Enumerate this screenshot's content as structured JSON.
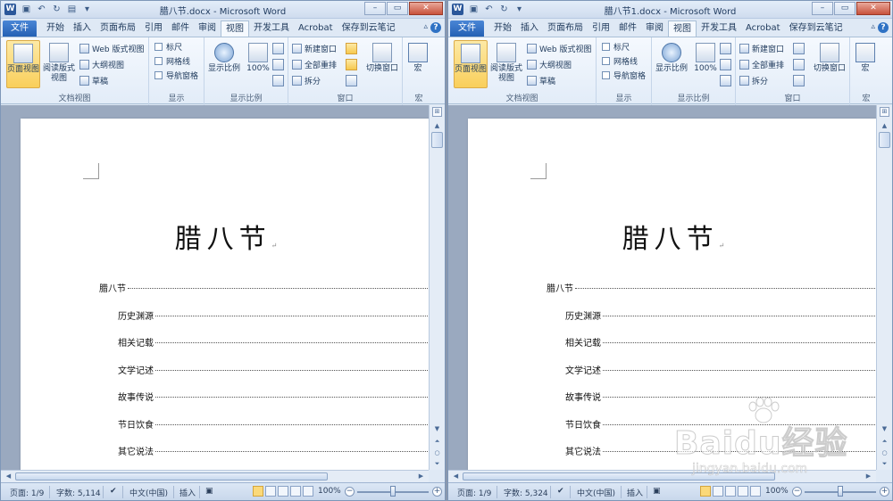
{
  "windows": [
    {
      "title": "腊八节.docx - Microsoft Word",
      "word_count": "字数: 5,114"
    },
    {
      "title": "腊八节1.docx - Microsoft Word",
      "word_count": "字数: 5,324"
    }
  ],
  "common": {
    "app_icon": "W",
    "file_tab": "文件",
    "tabs": [
      "开始",
      "插入",
      "页面布局",
      "引用",
      "邮件",
      "审阅",
      "视图",
      "开发工具",
      "Acrobat",
      "保存到云笔记"
    ],
    "active_tab": "视图",
    "ribbon": {
      "doc_views": {
        "label": "文档视图",
        "page_view": "页面视图",
        "reading_view": "阅读版式视图",
        "web_view": "Web 版式视图",
        "outline": "大纲视图",
        "draft": "草稿"
      },
      "show": {
        "label": "显示",
        "ruler": "标尺",
        "gridlines": "网格线",
        "nav_pane": "导航窗格"
      },
      "zoom": {
        "label": "显示比例",
        "zoom_btn": "显示比例",
        "hundred": "100%"
      },
      "window": {
        "label": "窗口",
        "new_window": "新建窗口",
        "arrange_all": "全部重排",
        "split": "拆分",
        "switch_windows": "切换窗口"
      },
      "macros": {
        "label": "宏",
        "macro_btn": "宏"
      }
    },
    "document": {
      "title": "腊八节",
      "toc": [
        {
          "text": "腊八节",
          "level": 1
        },
        {
          "text": "历史渊源",
          "level": 2
        },
        {
          "text": "相关记载",
          "level": 2
        },
        {
          "text": "文学记述",
          "level": 2
        },
        {
          "text": "故事传说",
          "level": 2
        },
        {
          "text": "节日饮食",
          "level": 2
        },
        {
          "text": "其它说法",
          "level": 2
        }
      ]
    },
    "status": {
      "page": "页面: 1/9",
      "language": "中文(中国)",
      "insert_mode": "插入",
      "zoom": "100%",
      "zoom_level": 1.0
    }
  },
  "watermark": {
    "main": "Baidu经验",
    "sub": "jingyan.baidu.com"
  },
  "colors": {
    "file_tab": "#2461b4",
    "active_button": "#f9cf5b",
    "ribbon_bg": "#e2ecf8",
    "close_button": "#c8523c"
  }
}
